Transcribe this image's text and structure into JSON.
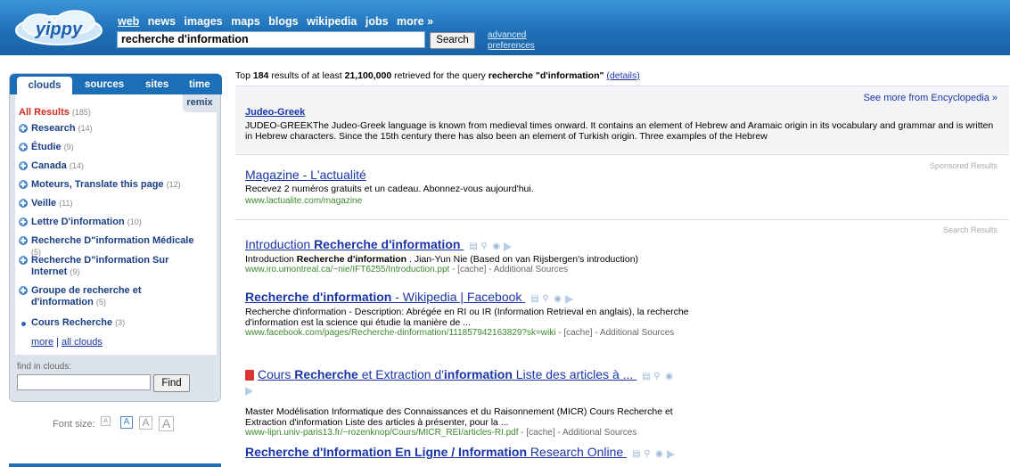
{
  "header": {
    "logo_text": "yippy",
    "nav": [
      "web",
      "news",
      "images",
      "maps",
      "blogs",
      "wikipedia",
      "jobs",
      "more »"
    ],
    "query": "recherche d'information",
    "search_button": "Search",
    "advanced": "advanced",
    "preferences": "preferences"
  },
  "sidebar": {
    "tabs": [
      "clouds",
      "sources",
      "sites",
      "time"
    ],
    "remix": "remix",
    "all_results_label": "All Results",
    "all_results_count": "(185)",
    "items": [
      {
        "label": "Research",
        "count": "(14)"
      },
      {
        "label": "Étudie",
        "count": "(9)"
      },
      {
        "label": "Canada",
        "count": "(14)"
      },
      {
        "label": "Moteurs, Translate this page",
        "count": "(12)"
      },
      {
        "label": "Veille",
        "count": "(11)"
      },
      {
        "label": "Lettre D'information",
        "count": "(10)"
      },
      {
        "label": "Recherche D\"information Médicale",
        "count": "(5)"
      },
      {
        "label": "Recherche D\"information Sur Internet",
        "count": "(9)"
      },
      {
        "label": "Groupe de recherche et d'information",
        "count": "(5)"
      },
      {
        "label": "Cours Recherche",
        "count": "(3)"
      }
    ],
    "more": "more",
    "sep": "|",
    "all_clouds": "all clouds",
    "find_label": "find in clouds:",
    "find_button": "Find",
    "font_size_label": "Font size:"
  },
  "results_header": {
    "prefix": "Top",
    "count": "184",
    "middle": "results of at least",
    "total": "21,100,000",
    "middle2": "retrieved for the query",
    "query": "recherche \"d'information\"",
    "details": "(details)"
  },
  "encyclopedia": {
    "see_more": "See more from Encyclopedia »",
    "title": "Judeo-Greek",
    "desc": "JUDEO-GREEKThe Judeo-Greek language is known from medieval times onward. It contains an element of Hebrew and Aramaic origin in its vocabulary and grammar and is written in Hebrew characters. Since the 15th century there has also been an element of Turkish origin. Three examples of the Hebrew"
  },
  "sponsored": {
    "tag": "Sponsored Results",
    "title": "Magazine - L'actualité",
    "desc": "Recevez 2 numéros gratuits et un cadeau. Abonnez-vous aujourd'hui.",
    "url": "www.lactualite.com/magazine"
  },
  "search_results_tag": "Search Results",
  "results": [
    {
      "t1": "Introduction ",
      "t2": "Recherche d'information",
      "t3": "",
      "d1": "Introduction ",
      "d2": "Recherche d'information",
      "d3": " . Jian-Yun Nie (Based on van Rijsbergen's introduction)",
      "url": "www.iro.umontreal.ca/~nie/IFT6255/Introduction.ppt",
      "extra": " - [cache] - Additional Sources"
    },
    {
      "t1": "",
      "t2": "Recherche d'information",
      "t3": " - Wikipedia | Facebook",
      "desc_html": "Recherche d'information - Description: Abrégée en RI ou IR (Information Retrieval en anglais), la recherche d'information est la science qui étudie la manière de ...",
      "url": "www.facebook.com/pages/Recherche-dinformation/111857942163829?sk=wiki",
      "extra": " - [cache] - Additional Sources"
    },
    {
      "t1": "Cours ",
      "t2": "Recherche",
      "t3": " et Extraction d'",
      "t4": "information",
      "t5": " Liste des articles à ...",
      "desc": "Master Modélisation Informatique des Connaissances et du Raisonnement (MICR) Cours Recherche et Extraction d'information Liste des articles à présenter, pour la ...",
      "url": "www-lipn.univ-paris13.fr/~rozenknop/Cours/MICR_REI/articles-RI.pdf",
      "extra": " - [cache] - Additional Sources"
    },
    {
      "t1": "",
      "t2": "Recherche d'Information En Ligne / Information",
      "t3": " Research Online"
    }
  ]
}
